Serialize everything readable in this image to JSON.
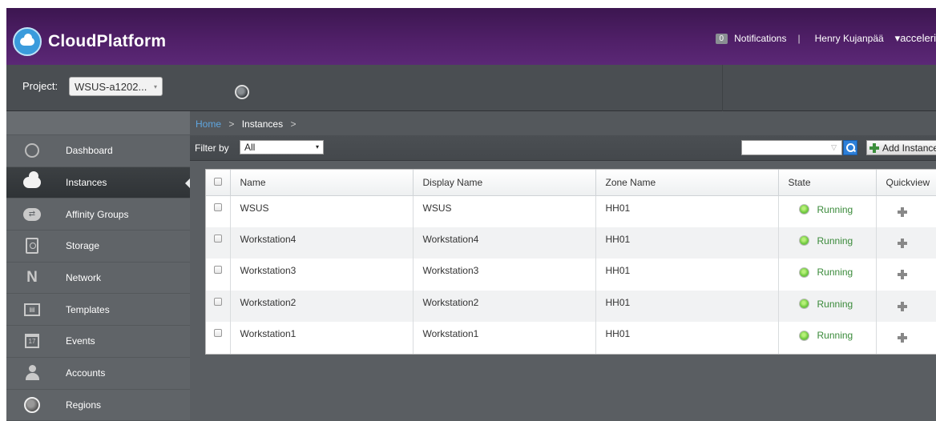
{
  "header": {
    "app_name": "CloudPlatform",
    "notifications_count": "0",
    "notifications_label": "Notifications",
    "separator": "|",
    "user": "Henry Kujanpää",
    "org": "▾acceleri"
  },
  "project_bar": {
    "label": "Project:",
    "selected": "WSUS-a1202...",
    "caret": "▾"
  },
  "sidebar": {
    "items": [
      {
        "label": "Dashboard",
        "icon": "dashboard-icon"
      },
      {
        "label": "Instances",
        "icon": "instances-cloud-icon",
        "active": true
      },
      {
        "label": "Affinity Groups",
        "icon": "affinity-groups-icon"
      },
      {
        "label": "Storage",
        "icon": "storage-icon"
      },
      {
        "label": "Network",
        "icon": "network-icon"
      },
      {
        "label": "Templates",
        "icon": "templates-icon"
      },
      {
        "label": "Events",
        "icon": "events-icon"
      },
      {
        "label": "Accounts",
        "icon": "accounts-icon"
      },
      {
        "label": "Regions",
        "icon": "regions-icon"
      }
    ]
  },
  "breadcrumb": {
    "home": "Home",
    "sep": ">",
    "current": "Instances",
    "sep2": ">"
  },
  "toolbar": {
    "filter_label": "Filter by",
    "filter_value": "All",
    "filter_caret": "▾",
    "search_caret": "▽",
    "add_label": "Add Instance"
  },
  "table": {
    "columns": [
      "Name",
      "Display Name",
      "Zone Name",
      "State",
      "Quickview"
    ],
    "rows": [
      {
        "name": "WSUS",
        "display_name": "WSUS",
        "zone": "HH01",
        "state": "Running"
      },
      {
        "name": "Workstation4",
        "display_name": "Workstation4",
        "zone": "HH01",
        "state": "Running"
      },
      {
        "name": "Workstation3",
        "display_name": "Workstation3",
        "zone": "HH01",
        "state": "Running"
      },
      {
        "name": "Workstation2",
        "display_name": "Workstation2",
        "zone": "HH01",
        "state": "Running"
      },
      {
        "name": "Workstation1",
        "display_name": "Workstation1",
        "zone": "HH01",
        "state": "Running"
      }
    ]
  },
  "colors": {
    "header_purple": "#4f1f67",
    "link_blue": "#5fa6e0",
    "running_green": "#3a8a3a"
  }
}
